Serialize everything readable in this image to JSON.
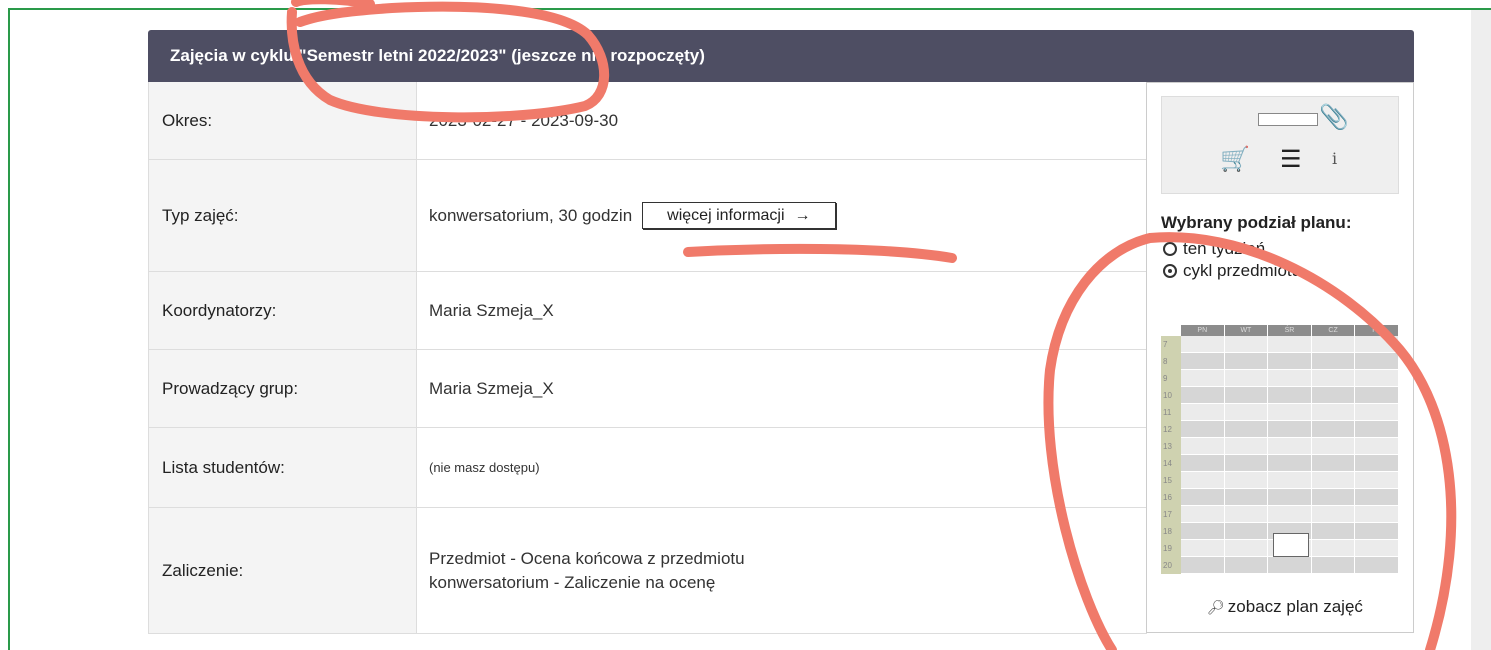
{
  "header": {
    "title": "Zajęcia w cyklu \"Semestr letni 2022/2023\" (jeszcze nie rozpoczęty)"
  },
  "rows": [
    {
      "label": "Okres:",
      "value": "2023-02-27 - 2023-09-30"
    },
    {
      "label": "Typ zajęć:",
      "value": "konwersatorium, 30 godzin",
      "button": "więcej informacji",
      "button_arrow": "→"
    },
    {
      "label": "Koordynatorzy:",
      "value": "Maria Szmeja_X"
    },
    {
      "label": "Prowadzący grup:",
      "value": "Maria Szmeja_X"
    },
    {
      "label": "Lista studentów:",
      "value": "(nie masz dostępu)"
    },
    {
      "label": "Zaliczenie:",
      "lines": [
        "Przedmiot - Ocena końcowa z przedmiotu",
        "konwersatorium - Zaliczenie na ocenę"
      ]
    }
  ],
  "side": {
    "icons": [
      "paperclip-icon",
      "cart-icon",
      "list-icon",
      "info-icon"
    ],
    "info_glyph": "i",
    "plan_title": "Wybrany podział planu:",
    "options": [
      {
        "label": "ten tydzień",
        "selected": false
      },
      {
        "label": "cykl przedmiotu",
        "selected": true
      }
    ],
    "days": [
      "PN",
      "WT",
      "ŚR",
      "CZ",
      "PT"
    ],
    "hours": [
      "7",
      "8",
      "9",
      "10",
      "11",
      "12",
      "13",
      "14",
      "15",
      "16",
      "17",
      "18",
      "19",
      "20"
    ],
    "view_link": "zobacz plan zajęć"
  },
  "colors": {
    "header_bg": "#4e4e63",
    "frame_border": "#2a9a4a",
    "annotation": "#f07a6a",
    "cart": "#2a9a2a"
  }
}
